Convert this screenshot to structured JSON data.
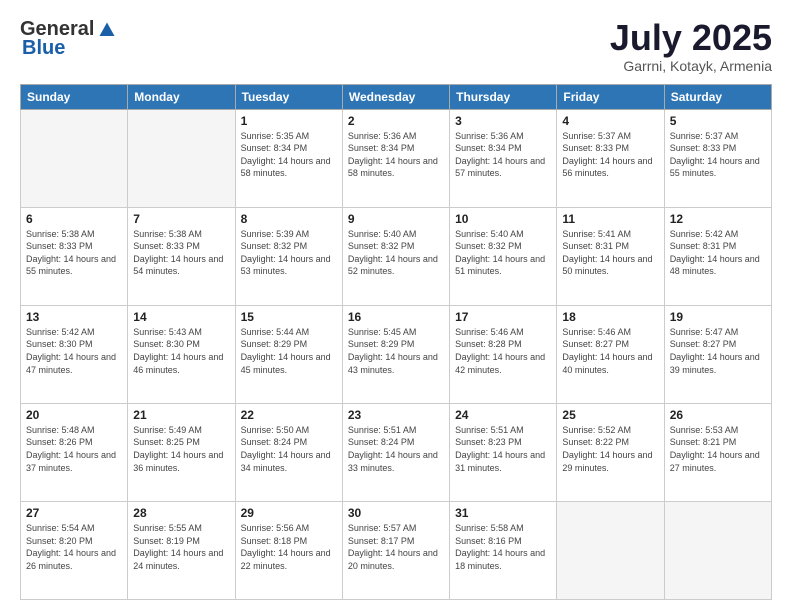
{
  "header": {
    "logo_general": "General",
    "logo_blue": "Blue",
    "month_title": "July 2025",
    "location": "Garrni, Kotayk, Armenia"
  },
  "days_of_week": [
    "Sunday",
    "Monday",
    "Tuesday",
    "Wednesday",
    "Thursday",
    "Friday",
    "Saturday"
  ],
  "weeks": [
    [
      {
        "day": "",
        "sunrise": "",
        "sunset": "",
        "daylight": "",
        "empty": true
      },
      {
        "day": "",
        "sunrise": "",
        "sunset": "",
        "daylight": "",
        "empty": true
      },
      {
        "day": "1",
        "sunrise": "Sunrise: 5:35 AM",
        "sunset": "Sunset: 8:34 PM",
        "daylight": "Daylight: 14 hours and 58 minutes."
      },
      {
        "day": "2",
        "sunrise": "Sunrise: 5:36 AM",
        "sunset": "Sunset: 8:34 PM",
        "daylight": "Daylight: 14 hours and 58 minutes."
      },
      {
        "day": "3",
        "sunrise": "Sunrise: 5:36 AM",
        "sunset": "Sunset: 8:34 PM",
        "daylight": "Daylight: 14 hours and 57 minutes."
      },
      {
        "day": "4",
        "sunrise": "Sunrise: 5:37 AM",
        "sunset": "Sunset: 8:33 PM",
        "daylight": "Daylight: 14 hours and 56 minutes."
      },
      {
        "day": "5",
        "sunrise": "Sunrise: 5:37 AM",
        "sunset": "Sunset: 8:33 PM",
        "daylight": "Daylight: 14 hours and 55 minutes."
      }
    ],
    [
      {
        "day": "6",
        "sunrise": "Sunrise: 5:38 AM",
        "sunset": "Sunset: 8:33 PM",
        "daylight": "Daylight: 14 hours and 55 minutes."
      },
      {
        "day": "7",
        "sunrise": "Sunrise: 5:38 AM",
        "sunset": "Sunset: 8:33 PM",
        "daylight": "Daylight: 14 hours and 54 minutes."
      },
      {
        "day": "8",
        "sunrise": "Sunrise: 5:39 AM",
        "sunset": "Sunset: 8:32 PM",
        "daylight": "Daylight: 14 hours and 53 minutes."
      },
      {
        "day": "9",
        "sunrise": "Sunrise: 5:40 AM",
        "sunset": "Sunset: 8:32 PM",
        "daylight": "Daylight: 14 hours and 52 minutes."
      },
      {
        "day": "10",
        "sunrise": "Sunrise: 5:40 AM",
        "sunset": "Sunset: 8:32 PM",
        "daylight": "Daylight: 14 hours and 51 minutes."
      },
      {
        "day": "11",
        "sunrise": "Sunrise: 5:41 AM",
        "sunset": "Sunset: 8:31 PM",
        "daylight": "Daylight: 14 hours and 50 minutes."
      },
      {
        "day": "12",
        "sunrise": "Sunrise: 5:42 AM",
        "sunset": "Sunset: 8:31 PM",
        "daylight": "Daylight: 14 hours and 48 minutes."
      }
    ],
    [
      {
        "day": "13",
        "sunrise": "Sunrise: 5:42 AM",
        "sunset": "Sunset: 8:30 PM",
        "daylight": "Daylight: 14 hours and 47 minutes."
      },
      {
        "day": "14",
        "sunrise": "Sunrise: 5:43 AM",
        "sunset": "Sunset: 8:30 PM",
        "daylight": "Daylight: 14 hours and 46 minutes."
      },
      {
        "day": "15",
        "sunrise": "Sunrise: 5:44 AM",
        "sunset": "Sunset: 8:29 PM",
        "daylight": "Daylight: 14 hours and 45 minutes."
      },
      {
        "day": "16",
        "sunrise": "Sunrise: 5:45 AM",
        "sunset": "Sunset: 8:29 PM",
        "daylight": "Daylight: 14 hours and 43 minutes."
      },
      {
        "day": "17",
        "sunrise": "Sunrise: 5:46 AM",
        "sunset": "Sunset: 8:28 PM",
        "daylight": "Daylight: 14 hours and 42 minutes."
      },
      {
        "day": "18",
        "sunrise": "Sunrise: 5:46 AM",
        "sunset": "Sunset: 8:27 PM",
        "daylight": "Daylight: 14 hours and 40 minutes."
      },
      {
        "day": "19",
        "sunrise": "Sunrise: 5:47 AM",
        "sunset": "Sunset: 8:27 PM",
        "daylight": "Daylight: 14 hours and 39 minutes."
      }
    ],
    [
      {
        "day": "20",
        "sunrise": "Sunrise: 5:48 AM",
        "sunset": "Sunset: 8:26 PM",
        "daylight": "Daylight: 14 hours and 37 minutes."
      },
      {
        "day": "21",
        "sunrise": "Sunrise: 5:49 AM",
        "sunset": "Sunset: 8:25 PM",
        "daylight": "Daylight: 14 hours and 36 minutes."
      },
      {
        "day": "22",
        "sunrise": "Sunrise: 5:50 AM",
        "sunset": "Sunset: 8:24 PM",
        "daylight": "Daylight: 14 hours and 34 minutes."
      },
      {
        "day": "23",
        "sunrise": "Sunrise: 5:51 AM",
        "sunset": "Sunset: 8:24 PM",
        "daylight": "Daylight: 14 hours and 33 minutes."
      },
      {
        "day": "24",
        "sunrise": "Sunrise: 5:51 AM",
        "sunset": "Sunset: 8:23 PM",
        "daylight": "Daylight: 14 hours and 31 minutes."
      },
      {
        "day": "25",
        "sunrise": "Sunrise: 5:52 AM",
        "sunset": "Sunset: 8:22 PM",
        "daylight": "Daylight: 14 hours and 29 minutes."
      },
      {
        "day": "26",
        "sunrise": "Sunrise: 5:53 AM",
        "sunset": "Sunset: 8:21 PM",
        "daylight": "Daylight: 14 hours and 27 minutes."
      }
    ],
    [
      {
        "day": "27",
        "sunrise": "Sunrise: 5:54 AM",
        "sunset": "Sunset: 8:20 PM",
        "daylight": "Daylight: 14 hours and 26 minutes."
      },
      {
        "day": "28",
        "sunrise": "Sunrise: 5:55 AM",
        "sunset": "Sunset: 8:19 PM",
        "daylight": "Daylight: 14 hours and 24 minutes."
      },
      {
        "day": "29",
        "sunrise": "Sunrise: 5:56 AM",
        "sunset": "Sunset: 8:18 PM",
        "daylight": "Daylight: 14 hours and 22 minutes."
      },
      {
        "day": "30",
        "sunrise": "Sunrise: 5:57 AM",
        "sunset": "Sunset: 8:17 PM",
        "daylight": "Daylight: 14 hours and 20 minutes."
      },
      {
        "day": "31",
        "sunrise": "Sunrise: 5:58 AM",
        "sunset": "Sunset: 8:16 PM",
        "daylight": "Daylight: 14 hours and 18 minutes."
      },
      {
        "day": "",
        "sunrise": "",
        "sunset": "",
        "daylight": "",
        "empty": true
      },
      {
        "day": "",
        "sunrise": "",
        "sunset": "",
        "daylight": "",
        "empty": true
      }
    ]
  ]
}
